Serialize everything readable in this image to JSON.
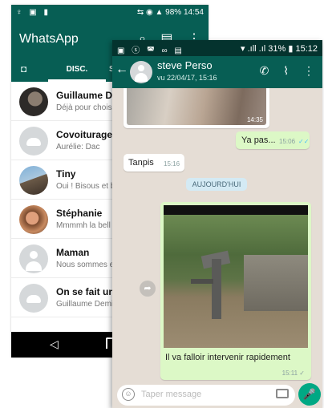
{
  "phone_a": {
    "status": {
      "left_icons": "♀ ▣ ▮",
      "right": "⇆ ◉ ▲ 98% 14:54"
    },
    "toolbar": {
      "title": "WhatsApp",
      "search_icon": "search-icon",
      "compose_icon": "chat-icon",
      "menu_icon": "more-icon"
    },
    "tabs": {
      "camera_icon": "camera-icon",
      "disc": "DISC.",
      "partial": "S"
    },
    "chats": [
      {
        "name": "Guillaume De",
        "preview": "Déjà pour chois"
      },
      {
        "name": "Covoiturage n",
        "preview": "Aurélie: Dac"
      },
      {
        "name": "Tiny",
        "preview": "Oui ! Bisous et b"
      },
      {
        "name": "Stéphanie",
        "preview": "Mmmmh la bell"
      },
      {
        "name": "Maman",
        "preview": "Nous sommes e"
      },
      {
        "name": "On se fait une",
        "preview": "Guillaume Demi"
      }
    ],
    "nav": {
      "back": "◁"
    }
  },
  "phone_b": {
    "status": {
      "left_icons": "▣ ⓢ ◚ ∞ ▤",
      "right": "▾ .ıll .ıl 31% ▮ 15:12"
    },
    "toolbar": {
      "back": "←",
      "contact_name": "steve Perso",
      "last_seen": "vu 22/04/17, 15:16",
      "call_icon": "✆",
      "attach_icon": "⌇",
      "menu_icon": "⋮"
    },
    "messages": {
      "top_image_time": "14:35",
      "ya_pas": {
        "text": "Ya pas...",
        "time": "15:06",
        "ticks": "✓✓"
      },
      "tanpis": {
        "text": "Tanpis",
        "time": "15:16"
      },
      "date_chip": "AUJOURD'HUI",
      "image": {
        "caption": "Il va falloir intervenir rapidement",
        "time": "15:11",
        "ticks": "✓"
      }
    },
    "forward_icon": "➦",
    "input": {
      "placeholder": "Taper message",
      "emoji": "☺"
    },
    "mic_icon": "🎤"
  }
}
